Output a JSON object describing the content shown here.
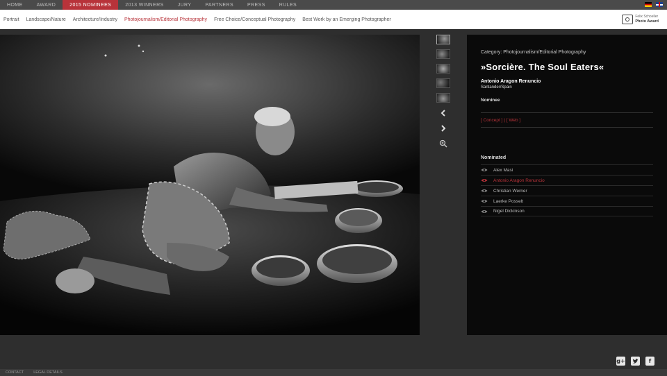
{
  "topnav": [
    "HOME",
    "AWARD",
    "2015 NOMINEES",
    "2013 WINNERS",
    "JURY",
    "PARTNERS",
    "PRESS",
    "RULES"
  ],
  "topnav_active": 2,
  "subnav": [
    "Portrait",
    "Landscape/Nature",
    "Architecture/Industry",
    "Photojournalism/Editorial Photography",
    "Free Choice/Conceptual Photography",
    "Best Work by an Emerging Photographer"
  ],
  "subnav_active": 3,
  "logo": {
    "line1": "Felix Schoeller",
    "line2": "Photo Award"
  },
  "panel": {
    "category": "Category: Photojournalism/Editorial Photography",
    "title": "»Sorcière. The Soul Eaters«",
    "author": "Antonio Aragon Renuncio",
    "location": "Santander/Spain",
    "status": "Nominee",
    "link_concept": "[ Concept ]",
    "link_sep": "|",
    "link_web": "[ Web ]",
    "nominated_heading": "Nominated"
  },
  "nominees": [
    "Alex Masi",
    "Antonio Aragon Renuncio",
    "Christian Werner",
    "Laerke Posselt",
    "Nigel Dickinson"
  ],
  "nominee_active": 1,
  "footer": [
    "CONTACT",
    "LEGAL DETAILS"
  ],
  "social_icons": [
    "google-plus-icon",
    "twitter-icon",
    "facebook-icon"
  ],
  "colors": {
    "accent": "#b8333a",
    "nav_bg": "#4a4a4a",
    "panel_bg": "#0a0a0a",
    "page_bg": "#2e2e2e"
  }
}
